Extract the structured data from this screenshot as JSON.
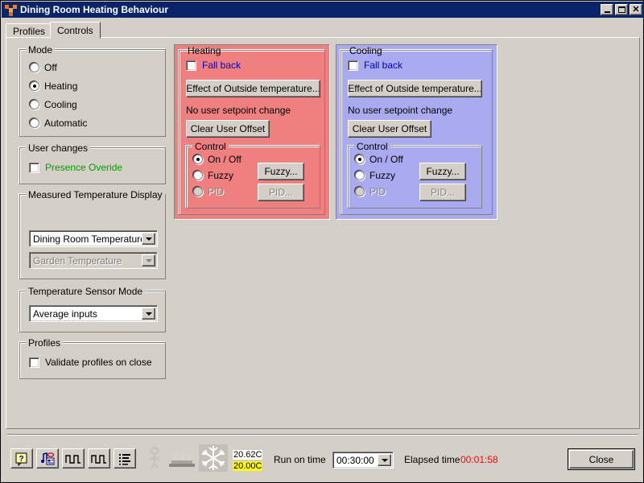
{
  "window": {
    "title": "Dining Room Heating Behaviour",
    "icon": "app-blocks-icon",
    "minimize_label": "_",
    "maximize_label": "□",
    "close_label": "✕"
  },
  "tabs": [
    {
      "label": "Profiles",
      "active": false
    },
    {
      "label": "Controls",
      "active": true
    }
  ],
  "mode_group": {
    "title": "Mode",
    "options": [
      {
        "label": "Off",
        "selected": false
      },
      {
        "label": "Heating",
        "selected": true
      },
      {
        "label": "Cooling",
        "selected": false
      },
      {
        "label": "Automatic",
        "selected": false
      }
    ]
  },
  "user_changes_group": {
    "title": "User changes",
    "checkbox": {
      "label": "Presence Overide",
      "checked": false,
      "color": "#00a000"
    }
  },
  "measured_temp_group": {
    "title": "Measured Temperature Display",
    "combo_primary": {
      "value": "Dining Room Temperature",
      "enabled": true
    },
    "combo_secondary": {
      "value": "Garden Temperature",
      "enabled": false
    }
  },
  "sensor_mode_group": {
    "title": "Temperature Sensor Mode",
    "combo": {
      "value": "Average inputs",
      "enabled": true
    }
  },
  "profiles_group": {
    "title": "Profiles",
    "checkbox": {
      "label": "Validate profiles on close",
      "checked": false
    }
  },
  "heating_panel": {
    "title": "Heating",
    "background": "#f08080",
    "fallback": {
      "label": "Fall back",
      "checked": false,
      "color": "#0000c0"
    },
    "outside_button": "Effect of Outside temperature...",
    "setpoint_status": "No user setpoint change",
    "clear_offset_button": "Clear User Offset",
    "control_group": {
      "title": "Control",
      "options": [
        {
          "label": "On / Off",
          "selected": true,
          "enabled": true
        },
        {
          "label": "Fuzzy",
          "selected": false,
          "enabled": true
        },
        {
          "label": "PID",
          "selected": false,
          "enabled": false
        }
      ],
      "fuzzy_button": {
        "label": "Fuzzy...",
        "enabled": true
      },
      "pid_button": {
        "label": "PID...",
        "enabled": false
      }
    }
  },
  "cooling_panel": {
    "title": "Cooling",
    "background": "#aaaaf0",
    "fallback": {
      "label": "Fall back",
      "checked": false,
      "color": "#0000c0"
    },
    "outside_button": "Effect of Outside temperature...",
    "setpoint_status": "No user setpoint change",
    "clear_offset_button": "Clear User Offset",
    "control_group": {
      "title": "Control",
      "options": [
        {
          "label": "On / Off",
          "selected": true,
          "enabled": true
        },
        {
          "label": "Fuzzy",
          "selected": false,
          "enabled": true
        },
        {
          "label": "PID",
          "selected": false,
          "enabled": false
        }
      ],
      "fuzzy_button": {
        "label": "Fuzzy...",
        "enabled": true
      },
      "pid_button": {
        "label": "PID...",
        "enabled": false
      }
    }
  },
  "statusbar": {
    "toolbar_icons": [
      "help-icon",
      "profile-note-icon",
      "square-wave-icon",
      "square-wave-2-icon",
      "list-report-icon"
    ],
    "indicators": [
      "presence-person-icon",
      "heating-flames-icon",
      "cooling-snowflake-icon"
    ],
    "readout_measured": {
      "value": "20.62C",
      "background": "#ffffff"
    },
    "readout_setpoint": {
      "value": "20.00C",
      "background": "#ffff00"
    },
    "run_on_time_label": "Run on time",
    "run_on_time_value": "00:30:00",
    "elapsed_label": "Elapsed time",
    "elapsed_value": "00:01:58",
    "elapsed_color": "#ff0000",
    "close_button": "Close"
  }
}
